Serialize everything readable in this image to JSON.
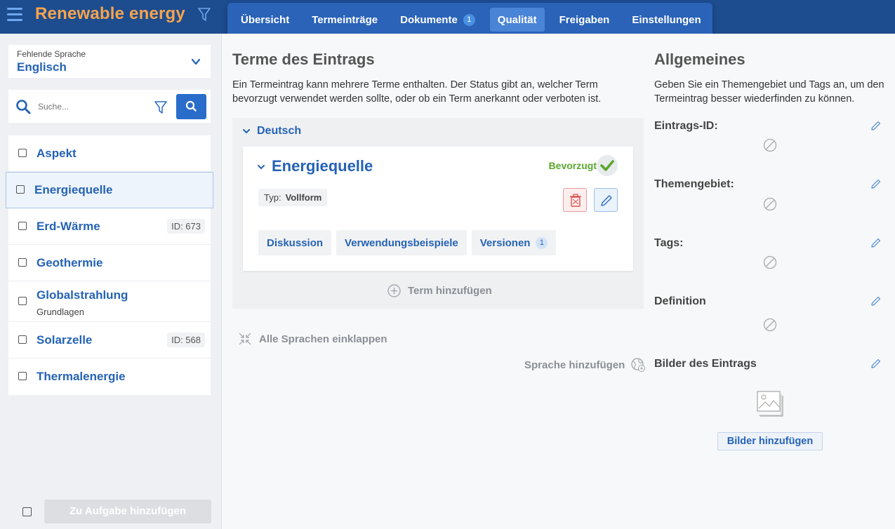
{
  "app": {
    "title": "Renewable energy"
  },
  "tabs": [
    {
      "label": "Übersicht"
    },
    {
      "label": "Termeinträge"
    },
    {
      "label": "Dokumente",
      "badge": "1"
    },
    {
      "label": "Qualität",
      "active": true
    },
    {
      "label": "Freigaben"
    },
    {
      "label": "Einstellungen"
    }
  ],
  "sidebar": {
    "language_select": {
      "label": "Fehlende Sprache",
      "value": "Englisch"
    },
    "search": {
      "placeholder": "Suche..."
    },
    "items": [
      {
        "name": "Aspekt"
      },
      {
        "name": "Energiequelle",
        "selected": true
      },
      {
        "name": "Erd-Wärme",
        "id": "ID: 673"
      },
      {
        "name": "Geothermie"
      },
      {
        "name": "Globalstrahlung",
        "sub": "Grundlagen"
      },
      {
        "name": "Solarzelle",
        "id": "ID: 568"
      },
      {
        "name": "Thermalenergie"
      }
    ],
    "bottom_button": "Zu Aufgabe hinzufügen"
  },
  "terms_section": {
    "title": "Terme des Eintrags",
    "description_line1": "Ein Termeintrag kann mehrere Terme enthalten. Der Status gibt an, welcher Term",
    "description_line2": "bevorzugt verwendet werden sollte, oder ob ein Term anerkannt oder verboten ist.",
    "language": "Deutsch",
    "term": {
      "name": "Energiequelle",
      "status": "Bevorzugt",
      "type_label": "Typ:",
      "type_value": "Vollform",
      "sub_tabs": [
        {
          "label": "Diskussion"
        },
        {
          "label": "Verwendungsbeispiele"
        },
        {
          "label": "Versionen",
          "badge": "1"
        }
      ]
    },
    "add_term": "Term hinzufügen",
    "collapse_all": "Alle Sprachen einklappen",
    "add_language": "Sprache hinzufügen"
  },
  "general_section": {
    "title": "Allgemeines",
    "description_line1": "Geben Sie ein Themengebiet und Tags an, um den",
    "description_line2": "Termeintrag besser wiederfinden zu können.",
    "fields": [
      {
        "label": "Eintrags-ID:"
      },
      {
        "label": "Themengebiet:"
      },
      {
        "label": "Tags:"
      },
      {
        "label": "Definition"
      },
      {
        "label": "Bilder des Eintrags"
      }
    ],
    "add_images_button": "Bilder hinzufügen"
  },
  "colors": {
    "topbar": "#1d4c8f",
    "tabs_bg": "#2a63b8",
    "title_orange": "#f6a44d",
    "link_blue": "#2563b5",
    "status_green": "#5aa72c"
  }
}
